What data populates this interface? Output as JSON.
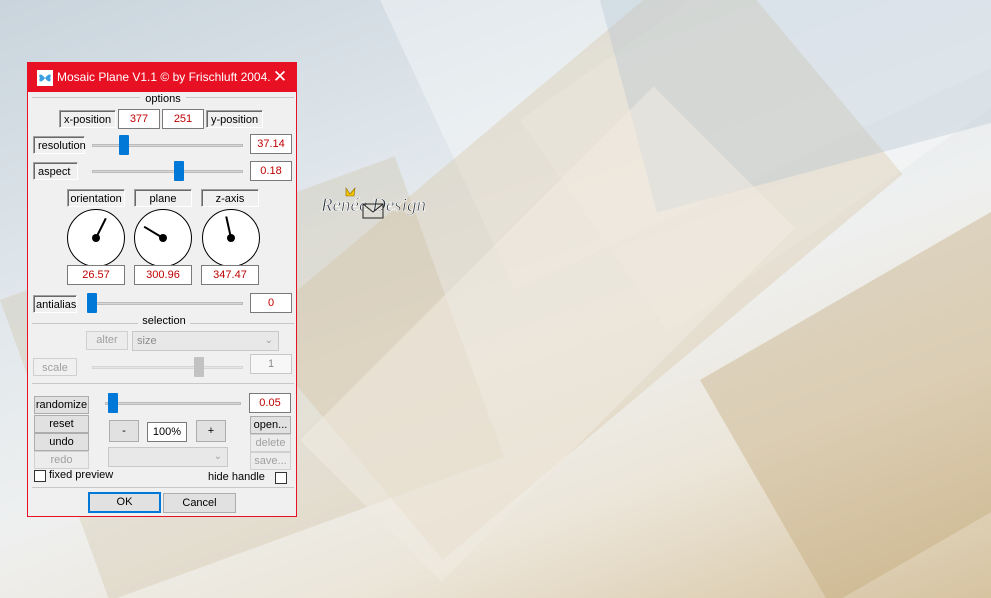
{
  "watermark": {
    "text": "Renée Design"
  },
  "dialog": {
    "title": "Mosaic Plane V1.1 © by Frischluft 2004.",
    "close_glyph": "✕",
    "colors": {
      "titlebar": "#e81123",
      "value_text": "#c00000",
      "accent": "#0078d7"
    }
  },
  "options": {
    "header": "options",
    "x_position": {
      "label": "x-position",
      "value": "377"
    },
    "y_position": {
      "label": "y-position",
      "value": "251"
    },
    "resolution": {
      "label": "resolution",
      "value": "37.14",
      "slider_fraction": 0.19
    },
    "aspect": {
      "label": "aspect",
      "value": "0.18",
      "slider_fraction": 0.58
    },
    "orientation": {
      "label": "orientation",
      "value": "26.57",
      "dial_angle_deg": 26.57
    },
    "plane": {
      "label": "plane",
      "value": "300.96",
      "dial_angle_deg": 300.96
    },
    "z_axis": {
      "label": "z-axis",
      "value": "347.47",
      "dial_angle_deg": 347.47
    },
    "antialias": {
      "label": "antialias",
      "value": "0",
      "slider_fraction": 0.0
    }
  },
  "selection": {
    "header": "selection",
    "alter_button": "alter",
    "size_select": "size",
    "scale": {
      "label": "scale",
      "value": "1",
      "slider_fraction": 0.72
    }
  },
  "bottom": {
    "randomize": {
      "label": "randomize",
      "value": "0.05",
      "slider_fraction": 0.02
    },
    "reset": "reset",
    "undo": "undo",
    "redo": "redo",
    "zoom_minus": "-",
    "zoom_value": "100%",
    "zoom_plus": "+",
    "open": "open...",
    "delete": "delete",
    "save": "save...",
    "preset_select": "",
    "fixed_preview": "fixed preview",
    "hide_handle": "hide handle",
    "ok": "OK",
    "cancel": "Cancel"
  }
}
